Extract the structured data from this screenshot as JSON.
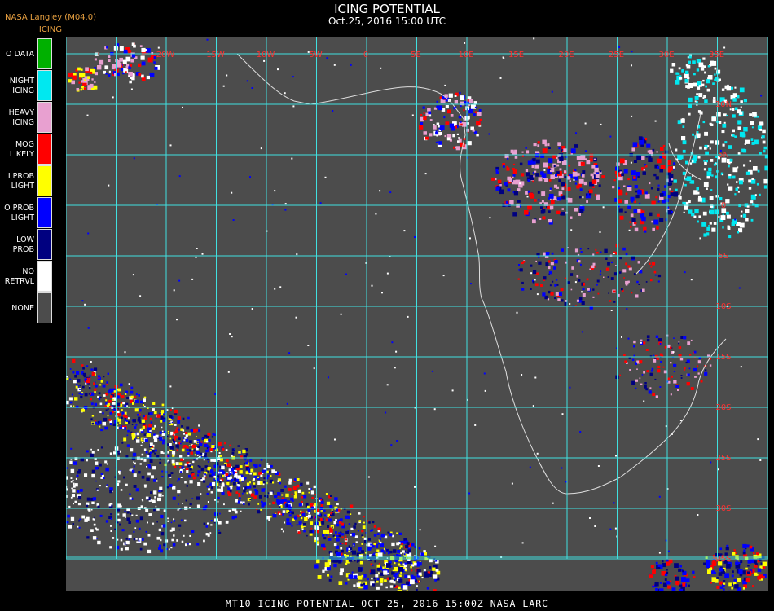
{
  "header": {
    "source": "NASA Langley (M04.0)",
    "product": "ICING",
    "title": "ICING POTENTIAL",
    "datetime": "Oct.25, 2016 15:00 UTC"
  },
  "legend": [
    {
      "label": "O DATA",
      "color": "#00b000"
    },
    {
      "label": "NIGHT\nICING",
      "color": "#00e8f0"
    },
    {
      "label": "HEAVY\nICING",
      "color": "#e8a0d0"
    },
    {
      "label": "MOG\nLIKELY",
      "color": "#ff0000"
    },
    {
      "label": "I PROB\nLIGHT",
      "color": "#ffff00"
    },
    {
      "label": "O PROB\nLIGHT",
      "color": "#0000ff"
    },
    {
      "label": "LOW\nPROB",
      "color": "#000080"
    },
    {
      "label": "NO\nRETRVL",
      "color": "#ffffff"
    },
    {
      "label": "NONE",
      "color": "#4c4c4c"
    }
  ],
  "grid": {
    "color": "#40e0e0",
    "top_labels": [
      "20W",
      "15W",
      "10W",
      "5W",
      "0",
      "5E",
      "10E",
      "15E",
      "20E",
      "25E",
      "30E",
      "35E"
    ],
    "right_labels": [
      "10N",
      "5N",
      "0",
      "5S",
      "10S",
      "15S",
      "20S",
      "25S",
      "30S",
      "35S",
      "40S"
    ]
  },
  "colors": {
    "background": "#000000",
    "map_background": "#4c4c4c",
    "coastline": "#dddddd",
    "label_red": "#ff3030"
  },
  "footer": "MT10  ICING POTENTIAL   OCT 25, 2016 15:00Z   NASA LARC"
}
